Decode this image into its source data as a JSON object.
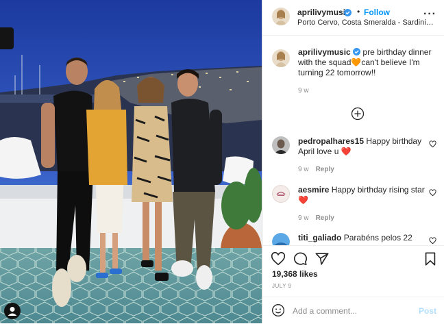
{
  "post": {
    "username": "aprilivymusic",
    "follow_label": "Follow",
    "separator": "•",
    "location": "Porto Cervo, Costa Smeralda - Sardinia, It...",
    "more_label": "···"
  },
  "caption": {
    "username": "aprilivymusic",
    "text": "pre birthday dinner with the squad🧡can't believe I'm turning 22 tomorrow!!",
    "time": "9 w"
  },
  "comments": [
    {
      "username": "pedropalhares15",
      "text": "Happy birthday April love u ❤️",
      "time": "9 w",
      "reply": "Reply",
      "avatar": "person-avatar"
    },
    {
      "username": "aesmire",
      "text": "Happy birthday rising star ❤️",
      "time": "9 w",
      "reply": "Reply",
      "avatar": "logo-avatar"
    },
    {
      "username": "titi_galiado",
      "text": "Parabéns pelos 22",
      "time": "",
      "reply": "",
      "avatar": "blue-avatar"
    }
  ],
  "actions": {
    "likes": "19,368 likes",
    "date": "JULY 9",
    "comment_placeholder": "Add a comment...",
    "post_label": "Post"
  },
  "colors": {
    "link": "#0095f6",
    "verified": "#3897f0",
    "heart": "#ed4956",
    "muted": "#8e8e8e"
  },
  "icons": [
    "verified-icon",
    "more-icon",
    "load-more-icon",
    "heart-icon",
    "comment-icon",
    "share-icon",
    "bookmark-icon",
    "emoji-icon",
    "user-tag-icon"
  ]
}
